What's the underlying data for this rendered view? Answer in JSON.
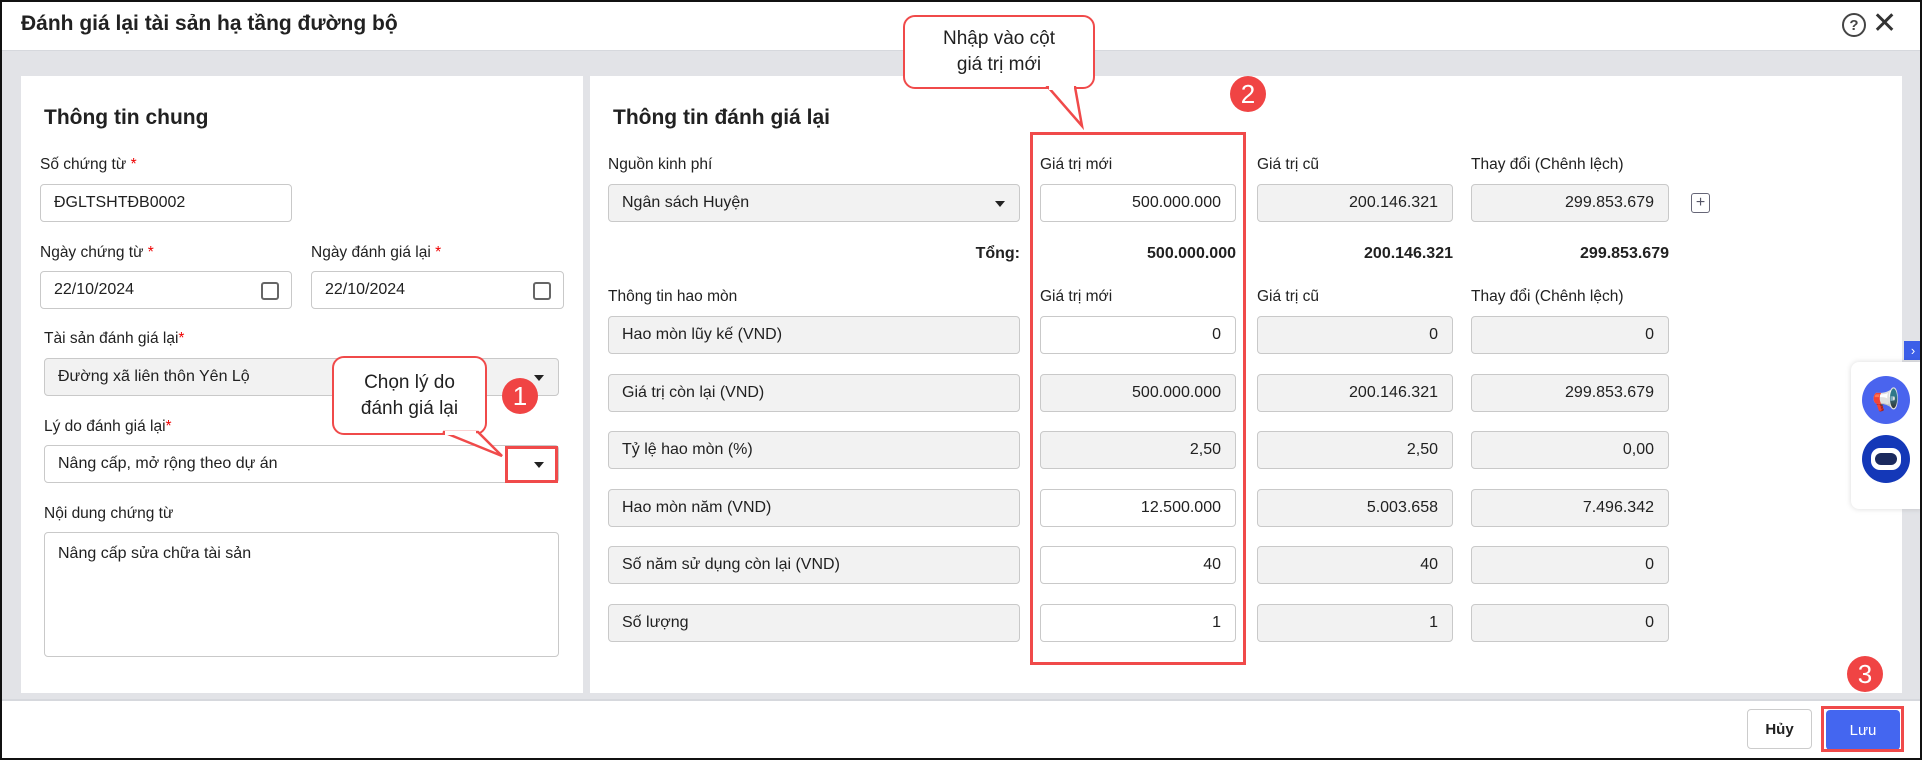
{
  "window": {
    "title": "Đánh giá lại tài sản hạ tầng đường bộ",
    "help_icon": "help-circle-icon",
    "close_icon": "close-icon"
  },
  "general": {
    "heading": "Thông tin chung",
    "voucher_no_label": "Số chứng từ",
    "voucher_no": "ĐGLTSHTĐB0002",
    "voucher_date_label": "Ngày chứng từ",
    "voucher_date": "22/10/2024",
    "revalue_date_label": "Ngày đánh giá lại",
    "revalue_date": "22/10/2024",
    "asset_label": "Tài sản đánh giá lại",
    "asset": "Đường xã liên thôn Yên Lộ",
    "reason_label": "Lý do đánh giá lại",
    "reason": "Nâng cấp, mở rộng theo dự án",
    "content_label": "Nội dung chứng từ",
    "content": "Nâng cấp sửa chữa tài sản",
    "required_mark": "*"
  },
  "revaluation": {
    "heading": "Thông tin đánh giá lại",
    "funding_label": "Nguồn kinh phí",
    "funding": "Ngân sách Huyện",
    "col_new": "Giá trị mới",
    "col_old": "Giá trị cũ",
    "col_change": "Thay đổi (Chênh lệch)",
    "funding_new": "500.000.000",
    "funding_old": "200.146.321",
    "funding_change": "299.853.679",
    "total_label": "Tổng:",
    "total_new": "500.000.000",
    "total_old": "200.146.321",
    "total_change": "299.853.679",
    "depreciation_label": "Thông tin hao mòn",
    "rows": [
      {
        "label": "Hao mòn lũy kế (VND)",
        "new": "0",
        "old": "0",
        "change": "0",
        "editable": true
      },
      {
        "label": "Giá trị còn lại (VND)",
        "new": "500.000.000",
        "old": "200.146.321",
        "change": "299.853.679",
        "editable": false
      },
      {
        "label": "Tỷ lệ hao mòn (%)",
        "new": "2,50",
        "old": "2,50",
        "change": "0,00",
        "editable": false
      },
      {
        "label": "Hao mòn năm (VND)",
        "new": "12.500.000",
        "old": "5.003.658",
        "change": "7.496.342",
        "editable": true
      },
      {
        "label": "Số năm sử dụng còn lại (VND)",
        "new": "40",
        "old": "40",
        "change": "0",
        "editable": true
      },
      {
        "label": "Số lượng",
        "new": "1",
        "old": "1",
        "change": "0",
        "editable": true
      }
    ]
  },
  "annotations": {
    "callout1": "Chọn lý do đánh giá lại",
    "callout2": "Nhập vào cột giá trị mới",
    "badge1": "1",
    "badge2": "2",
    "badge3": "3"
  },
  "footer": {
    "cancel": "Hủy",
    "save": "Lưu"
  },
  "colors": {
    "accent": "#4466f0",
    "annotation": "#f04444"
  }
}
